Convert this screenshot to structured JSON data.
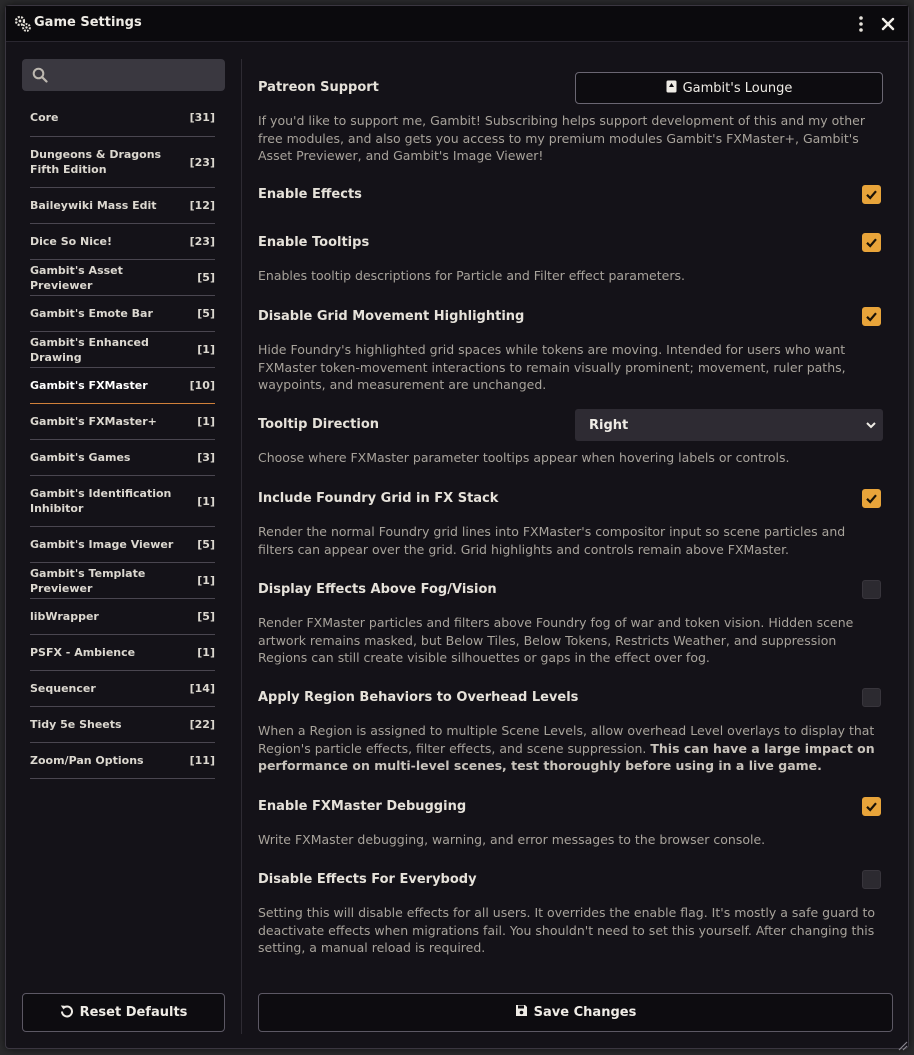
{
  "window": {
    "title": "Game Settings"
  },
  "search": {
    "placeholder": ""
  },
  "sidebar": {
    "items": [
      {
        "label": "Core",
        "count": "[31]"
      },
      {
        "label": "Dungeons & Dragons Fifth Edition",
        "count": "[23]"
      },
      {
        "label": "Baileywiki Mass Edit",
        "count": "[12]"
      },
      {
        "label": "Dice So Nice!",
        "count": "[23]"
      },
      {
        "label": "Gambit's Asset Previewer",
        "count": "[5]"
      },
      {
        "label": "Gambit's Emote Bar",
        "count": "[5]"
      },
      {
        "label": "Gambit's Enhanced Drawing",
        "count": "[1]"
      },
      {
        "label": "Gambit's FXMaster",
        "count": "[10]",
        "active": true
      },
      {
        "label": "Gambit's FXMaster+",
        "count": "[1]"
      },
      {
        "label": "Gambit's Games",
        "count": "[3]"
      },
      {
        "label": "Gambit's Identification Inhibitor",
        "count": "[1]"
      },
      {
        "label": "Gambit's Image Viewer",
        "count": "[5]"
      },
      {
        "label": "Gambit's Template Previewer",
        "count": "[1]"
      },
      {
        "label": "libWrapper",
        "count": "[5]"
      },
      {
        "label": "PSFX - Ambience",
        "count": "[1]"
      },
      {
        "label": "Sequencer",
        "count": "[14]"
      },
      {
        "label": "Tidy 5e Sheets",
        "count": "[22]"
      },
      {
        "label": "Zoom/Pan Options",
        "count": "[11]"
      }
    ]
  },
  "buttons": {
    "reset": "Reset Defaults",
    "save": "Save Changes"
  },
  "settings": {
    "patreon": {
      "label": "Patreon Support",
      "button": "Gambit's Lounge",
      "desc": "If you'd like to support me, Gambit! Subscribing helps support development of this and my other free modules, and also gets you access to my premium modules Gambit's FXMaster+, Gambit's Asset Previewer, and Gambit's Image Viewer!"
    },
    "enable_effects": {
      "label": "Enable Effects",
      "checked": true
    },
    "enable_tooltips": {
      "label": "Enable Tooltips",
      "checked": true,
      "desc": "Enables tooltip descriptions for Particle and Filter effect parameters."
    },
    "disable_grid": {
      "label": "Disable Grid Movement Highlighting",
      "checked": true,
      "desc": "Hide Foundry's highlighted grid spaces while tokens are moving. Intended for users who want FXMaster token-movement interactions to remain visually prominent; movement, ruler paths, waypoints, and measurement are unchanged."
    },
    "tooltip_direction": {
      "label": "Tooltip Direction",
      "value": "Right",
      "desc": "Choose where FXMaster parameter tooltips appear when hovering labels or controls."
    },
    "include_grid": {
      "label": "Include Foundry Grid in FX Stack",
      "checked": true,
      "desc": "Render the normal Foundry grid lines into FXMaster's compositor input so scene particles and filters can appear over the grid. Grid highlights and controls remain above FXMaster."
    },
    "above_fog": {
      "label": "Display Effects Above Fog/Vision",
      "checked": false,
      "desc": "Render FXMaster particles and filters above Foundry fog of war and token vision. Hidden scene artwork remains masked, but Below Tiles, Below Tokens, Restricts Weather, and suppression Regions can still create visible silhouettes or gaps in the effect over fog."
    },
    "region_overhead": {
      "label": "Apply Region Behaviors to Overhead Levels",
      "checked": false,
      "desc": "When a Region is assigned to multiple Scene Levels, allow overhead Level overlays to display that Region's particle effects, filter effects, and scene suppression.",
      "desc_bold": "This can have a large impact on performance on multi-level scenes, test thoroughly before using in a live game."
    },
    "debugging": {
      "label": "Enable FXMaster Debugging",
      "checked": true,
      "desc": "Write FXMaster debugging, warning, and error messages to the browser console."
    },
    "disable_everybody": {
      "label": "Disable Effects For Everybody",
      "checked": false,
      "desc": "Setting this will disable effects for all users. It overrides the enable flag. It's mostly a safe guard to deactivate effects when migrations fail. You shouldn't need to set this yourself. After changing this setting, a manual reload is required."
    }
  },
  "colors": {
    "accent": "#e8a43a",
    "active_underline": "#d0803a",
    "background": "#141218"
  }
}
